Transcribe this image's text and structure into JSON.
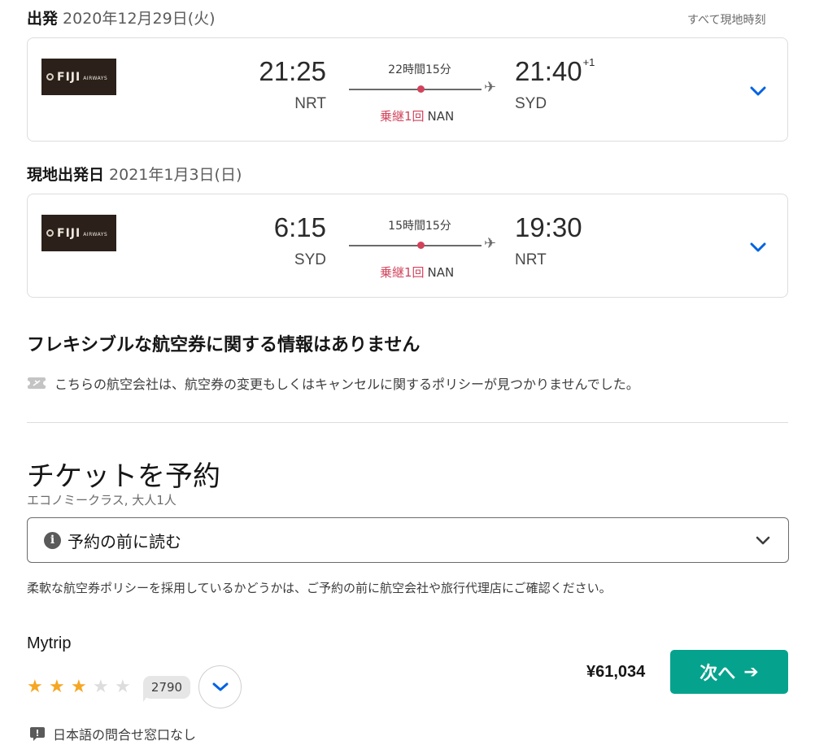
{
  "outbound": {
    "label": "出発",
    "date": "2020年12月29日(火)",
    "tz_note": "すべて現地時刻",
    "airline_logo_text": "FIJI",
    "airline_logo_sub": "AIRWAYS",
    "dep_time": "21:25",
    "dep_airport": "NRT",
    "duration": "22時間15分",
    "stops": "乗継1回",
    "via": "NAN",
    "arr_time": "21:40",
    "arr_day_offset": "+1",
    "arr_airport": "SYD"
  },
  "inbound": {
    "label": "現地出発日",
    "date": "2021年1月3日(日)",
    "airline_logo_text": "FIJI",
    "airline_logo_sub": "AIRWAYS",
    "dep_time": "6:15",
    "dep_airport": "SYD",
    "duration": "15時間15分",
    "stops": "乗継1回",
    "via": "NAN",
    "arr_time": "19:30",
    "arr_airport": "NRT"
  },
  "flex": {
    "title": "フレキシブルな航空券に関する情報はありません",
    "note": "こちらの航空会社は、航空券の変更もしくはキャンセルに関するポリシーが見つかりませんでした。"
  },
  "booking": {
    "title": "チケットを予約",
    "subtitle": "エコノミークラス, 大人1人",
    "read_before": "予約の前に読む",
    "notice": "柔軟な航空券ポリシーを採用しているかどうかは、ご予約の前に航空会社や旅行代理店にご確認ください。"
  },
  "provider": {
    "name": "Mytrip",
    "rating": 3,
    "rating_max": 5,
    "review_count": "2790",
    "price": "¥61,034",
    "next_label": "次へ",
    "language_note": "日本語の問合せ窓口なし"
  },
  "colors": {
    "accent_blue": "#0062e3",
    "stop_red": "#d1435b",
    "cta_green": "#05a38d",
    "star_gold": "#f5a623",
    "star_empty": "#dddddd"
  }
}
